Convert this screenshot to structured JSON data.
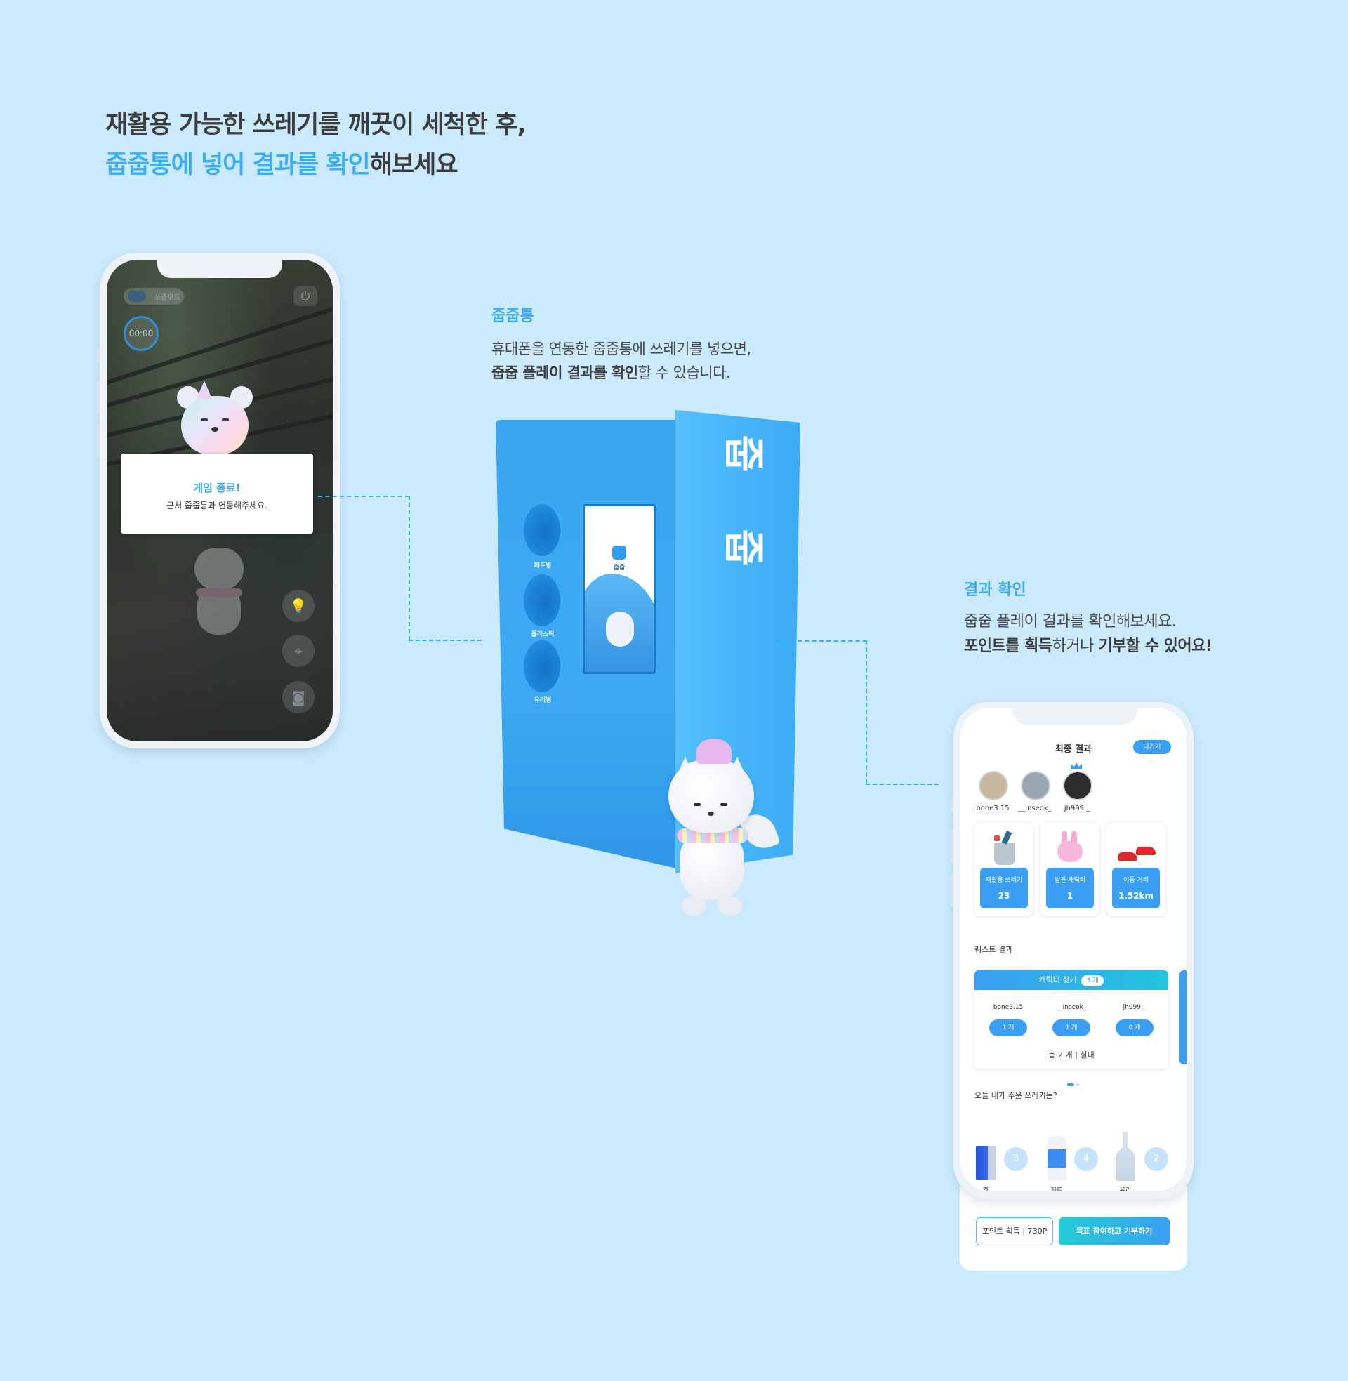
{
  "headline": {
    "line1": "재활용 가능한 쓰레기를 깨끗이 세척한 후,",
    "line2_highlight": "줍줍통에 넣어 결과를 확인",
    "line2_rest": "해보세요"
  },
  "left_phone": {
    "mode_label": "쓰줍모드",
    "timer": "00:00",
    "popup_title": "게임 종료!",
    "popup_desc": "근처 줍줍통과 연동해주세요."
  },
  "middle": {
    "label": "줍줍통",
    "desc_line1": "휴대폰을 연동한 줍줍통에 쓰레기를 넣으면,",
    "desc_bold": "줍줍 플레이 결과를 확인",
    "desc_rest": "할 수 있습니다."
  },
  "kiosk": {
    "slots": [
      "페트병",
      "플라스틱",
      "유리병"
    ],
    "screen_logo": "줍줍",
    "side_letters": [
      "줍",
      "줍"
    ]
  },
  "right": {
    "label": "결과 확인",
    "desc_line1": "줍줍 플레이 결과를 확인해보세요.",
    "bold1": "포인트를 획득",
    "mid": "하거나 ",
    "bold2": "기부할 수 있어요!"
  },
  "right_phone": {
    "title": "최종 결과",
    "exit_label": "나가기",
    "users": [
      "bone3.15",
      "__inseok_",
      "jh999._"
    ],
    "stats": [
      {
        "label": "재활용 쓰레기",
        "value": "23"
      },
      {
        "label": "발견 캐릭터",
        "value": "1"
      },
      {
        "label": "이동 거리",
        "value": "1.52km"
      }
    ],
    "quest_section": "퀘스트 결과",
    "quest_title": "캐릭터 찾기",
    "quest_count": "3 개",
    "quest_users": [
      "bone3.15",
      "__inseok_",
      "jh999._"
    ],
    "quest_values": [
      "1 개",
      "1 개",
      "0 개"
    ],
    "quest_total": "총 2 개 | 실패",
    "trash_section": "오늘 내가 주운 쓰레기는?",
    "trash": [
      {
        "label": "캔",
        "count": "3"
      },
      {
        "label": "페트",
        "count": "4"
      },
      {
        "label": "유리",
        "count": "2"
      }
    ],
    "point_btn": "포인트 획득 | 730P",
    "donate_btn": "목표 참여하고 기부하기"
  }
}
